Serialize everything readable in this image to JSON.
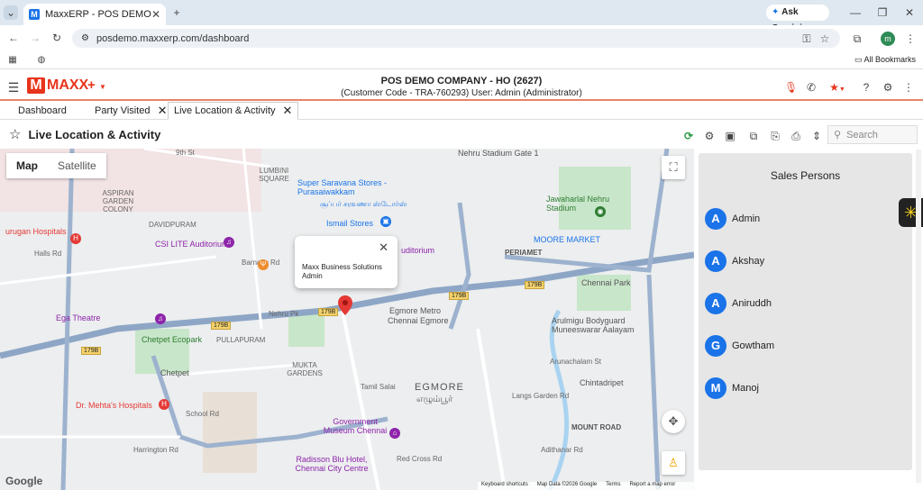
{
  "browser": {
    "tab_title": "MaxxERP - POS DEMO COMPAN",
    "url": "posdemo.maxxerp.com/dashboard",
    "ask_gemini": "Ask Gemini",
    "all_bookmarks": "All Bookmarks",
    "profile_initial": "m"
  },
  "app": {
    "logo": "MAXX",
    "company_line": "POS DEMO COMPANY - HO (2627)",
    "user_line": "(Customer Code - TRA-760293) User: Admin (Administrator)",
    "tabs": [
      {
        "label": "Dashboard"
      },
      {
        "label": "Party Visited"
      },
      {
        "label": "Live Location & Activity"
      }
    ],
    "page_title": "Live Location & Activity",
    "search_placeholder": "Search"
  },
  "map": {
    "type_map": "Map",
    "type_satellite": "Satellite",
    "popup_line1": "Maxx Business Solutions",
    "popup_line2": "Admin",
    "logo": "Google",
    "footer": [
      "Keyboard shortcuts",
      "Map Data ©2026 Google",
      "Terms",
      "Report a map error"
    ],
    "labels": {
      "nehru_gate": "Nehru Stadium Gate 1",
      "saravana": "Super Saravana Stores - Purasaiwakkam",
      "saravana_ta": "சூப்பர் சரவணா ஸ்டோர்ஸ்",
      "ismail": "Ismail Stores",
      "jawaharlal": "Jawaharlal Nehru Stadium",
      "csi": "CSI LITE Auditorium",
      "auditorium": "uditorium",
      "moore": "MOORE MARKET",
      "periamet": "PERIAMET",
      "chennai_park": "Chennai Park",
      "murugan": "urugan Hospitals",
      "ega": "Ega Theatre",
      "chetpet_eco": "Chetpet Ecopark",
      "pullapuram": "PULLAPURAM",
      "egmore_metro": "Egmore Metro",
      "chennai_egmore": "Chennai Egmore",
      "arulmigu": "Arulmigu Bodyguard Muneeswarar Aalayam",
      "chetpet": "Chetpet",
      "mukta": "MUKTA GARDENS",
      "egmore": "EGMORE",
      "egmore_ta": "எழும்பூர்",
      "chintadripet": "Chintadripet",
      "mehta": "Dr. Mehta's Hospitals",
      "museum": "Government Museum Chennai",
      "mount_road": "MOUNT ROAD",
      "radisson": "Radisson Blu Hotel, Chennai City Centre",
      "aspiran": "ASPIRAN GARDEN COLONY",
      "lumbini": "LUMBINI SQUARE",
      "davidpuram": "DAVIDPURAM",
      "nehru_pk": "Nehru Pk",
      "road_179b": "179B",
      "halls_rd": "Halls Rd",
      "barnaby": "Barnaby Rd",
      "school_rd": "School Rd",
      "harrington": "Harrington Rd",
      "tamil_salai": "Tamil Salai",
      "red_cross": "Red Cross Rd",
      "adithanar": "Adithanar Rd",
      "langs": "Langs Garden Rd",
      "arunachalam": "Arunachalam St",
      "ninth": "9th St"
    }
  },
  "sales": {
    "title": "Sales Persons",
    "persons": [
      {
        "initial": "A",
        "name": "Admin"
      },
      {
        "initial": "A",
        "name": "Akshay"
      },
      {
        "initial": "A",
        "name": "Aniruddh"
      },
      {
        "initial": "G",
        "name": "Gowtham"
      },
      {
        "initial": "M",
        "name": "Manoj"
      }
    ]
  },
  "colors": {
    "accent": "#1a73e8",
    "brand": "#e8341c",
    "refresh": "#2e9d4a",
    "star": "#e8341c"
  }
}
